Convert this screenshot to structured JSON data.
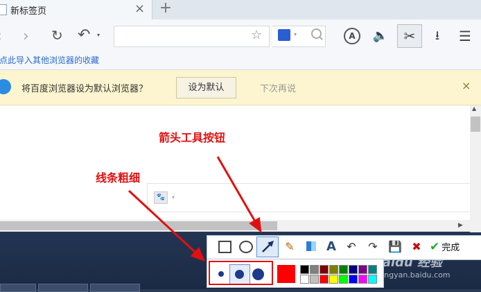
{
  "tab": {
    "title": "新标签页",
    "close": "×",
    "new_tab": "+"
  },
  "toolbar": {
    "back": "‹",
    "forward": "›",
    "reload": "↻",
    "undo": "↶",
    "undo_dropdown": "▾",
    "star": "☆",
    "search_engine_icon": "paw-icon",
    "adblock": "A",
    "sound": "🔈",
    "scissor": "✂",
    "download": "⭳",
    "menu": "☰"
  },
  "bookmarks": {
    "import_text": "点此导入其他浏览器的收藏"
  },
  "notify": {
    "text": "将百度浏览器设为默认浏览器？",
    "set_default": "设为默认",
    "later": "下次再说",
    "close": "×"
  },
  "annotations": {
    "arrow_tool": "箭头工具按钮",
    "line_width": "线条粗细"
  },
  "screenshot_tools": {
    "rect_icon": "rectangle-icon",
    "ellipse_icon": "ellipse-icon",
    "arrow": "↗",
    "brush": "✎",
    "mosaic_icon": "mosaic-icon",
    "text": "A",
    "undo": "↶",
    "redo": "↷",
    "save": "💾",
    "cancel": "✖",
    "done": "完成",
    "done_check": "✔"
  },
  "screenshot_props": {
    "selected_size": "medium",
    "current_color": "#ff0000",
    "palette_top": [
      "#000000",
      "#808080",
      "#800000",
      "#808000",
      "#008000",
      "#000080",
      "#800080",
      "#008080"
    ],
    "palette_bottom": [
      "#ffffff",
      "#c0c0c0",
      "#ff0000",
      "#ffff00",
      "#00ff00",
      "#0000ff",
      "#ff00ff",
      "#00ffff"
    ]
  },
  "watermark": {
    "logo": "Baidu 经验",
    "url": "jingyan.baidu.com"
  }
}
